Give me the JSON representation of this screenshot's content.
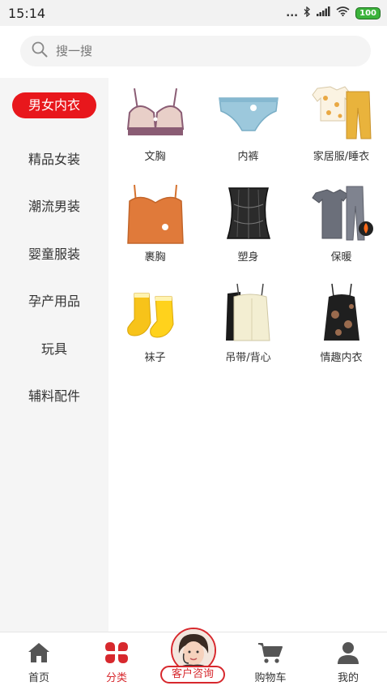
{
  "status_bar": {
    "time": "15:14",
    "dots": "...",
    "battery": "100"
  },
  "search": {
    "placeholder": "搜一搜"
  },
  "sidebar": {
    "items": [
      {
        "label": "男女内衣",
        "active": true
      },
      {
        "label": "精品女装",
        "active": false
      },
      {
        "label": "潮流男装",
        "active": false
      },
      {
        "label": "婴童服装",
        "active": false
      },
      {
        "label": "孕产用品",
        "active": false
      },
      {
        "label": "玩具",
        "active": false
      },
      {
        "label": "辅料配件",
        "active": false
      }
    ]
  },
  "grid": {
    "items": [
      {
        "label": "文胸",
        "icon": "bra-icon"
      },
      {
        "label": "内裤",
        "icon": "panties-icon"
      },
      {
        "label": "家居服/睡衣",
        "icon": "pajamas-icon"
      },
      {
        "label": "裹胸",
        "icon": "tube-top-icon"
      },
      {
        "label": "塑身",
        "icon": "corset-icon"
      },
      {
        "label": "保暖",
        "icon": "thermal-wear-icon"
      },
      {
        "label": "袜子",
        "icon": "socks-icon"
      },
      {
        "label": "吊带/背心",
        "icon": "camisole-icon"
      },
      {
        "label": "情趣内衣",
        "icon": "lingerie-icon"
      }
    ]
  },
  "tabbar": {
    "items": [
      {
        "label": "首页",
        "icon": "home-icon",
        "active": false
      },
      {
        "label": "分类",
        "icon": "category-icon",
        "active": true
      },
      {
        "label": "客户咨询",
        "icon": "customer-service-avatar",
        "active": false
      },
      {
        "label": "购物车",
        "icon": "cart-icon",
        "active": false
      },
      {
        "label": "我的",
        "icon": "user-icon",
        "active": false
      }
    ]
  },
  "colors": {
    "accent": "#e8171c",
    "sidebar_bg": "#f5f5f5",
    "battery_green": "#3bb33b"
  }
}
